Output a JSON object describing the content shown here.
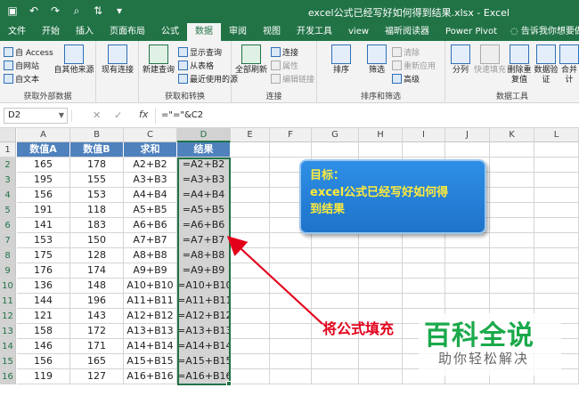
{
  "titlebar": {
    "title": "excel公式已经写好如何得到结果.xlsx  -  Excel"
  },
  "tabs": [
    "文件",
    "开始",
    "插入",
    "页面布局",
    "公式",
    "数据",
    "审阅",
    "视图",
    "开发工具",
    "view",
    "福昕阅读器",
    "Power Pivot"
  ],
  "active_tab_index": 5,
  "tellme": "告诉我你想要做什么",
  "ribbon": {
    "external": {
      "label": "获取外部数据",
      "access": "自 Access",
      "web": "自网站",
      "text": "自文本",
      "other": "自其他来源",
      "existing": "现有连接"
    },
    "transform": {
      "label": "获取和转换",
      "newquery": "新建查询",
      "show": "显示查询",
      "fromtable": "从表格",
      "recent": "最近使用的源"
    },
    "connections": {
      "label": "连接",
      "refresh": "全部刷新",
      "conn": "连接",
      "props": "属性",
      "editlinks": "编辑链接"
    },
    "sortfilter": {
      "label": "排序和筛选",
      "sort": "排序",
      "filter": "筛选",
      "clear": "清除",
      "reapply": "重新应用",
      "advanced": "高级"
    },
    "datatools": {
      "label": "数据工具",
      "split": "分列",
      "flash": "快速填充",
      "dedup": "删除重复值",
      "validate": "数据验证",
      "merge": "合并计"
    }
  },
  "formula": {
    "namebox": "D2",
    "content": "=\"=\"&C2"
  },
  "columns": [
    "A",
    "B",
    "C",
    "D",
    "E",
    "F",
    "G",
    "H",
    "I",
    "J",
    "K",
    "L"
  ],
  "headers": [
    "数值A",
    "数值B",
    "求和",
    "结果"
  ],
  "rows": [
    [
      "165",
      "178",
      "A2+B2",
      "=A2+B2"
    ],
    [
      "195",
      "155",
      "A3+B3",
      "=A3+B3"
    ],
    [
      "156",
      "153",
      "A4+B4",
      "=A4+B4"
    ],
    [
      "191",
      "118",
      "A5+B5",
      "=A5+B5"
    ],
    [
      "141",
      "183",
      "A6+B6",
      "=A6+B6"
    ],
    [
      "153",
      "150",
      "A7+B7",
      "=A7+B7"
    ],
    [
      "175",
      "128",
      "A8+B8",
      "=A8+B8"
    ],
    [
      "176",
      "174",
      "A9+B9",
      "=A9+B9"
    ],
    [
      "136",
      "148",
      "A10+B10",
      "=A10+B10"
    ],
    [
      "144",
      "196",
      "A11+B11",
      "=A11+B11"
    ],
    [
      "121",
      "143",
      "A12+B12",
      "=A12+B12"
    ],
    [
      "158",
      "172",
      "A13+B13",
      "=A13+B13"
    ],
    [
      "146",
      "171",
      "A14+B14",
      "=A14+B14"
    ],
    [
      "156",
      "165",
      "A15+B15",
      "=A15+B15"
    ],
    [
      "119",
      "127",
      "A16+B16",
      "=A16+B16"
    ]
  ],
  "callout": {
    "line1": "目标：",
    "line2": "excel公式已经写好如何得",
    "line3": "到结果"
  },
  "red_note": "将公式填充",
  "watermark": {
    "main": "百科全说",
    "sub": "助你轻松解决"
  },
  "colors": {
    "excel_green": "#217346",
    "header_blue": "#4f81bd",
    "callout_blue": "#1f73c9",
    "note_red": "#e3001b",
    "watermark_green": "#1aa94b"
  }
}
